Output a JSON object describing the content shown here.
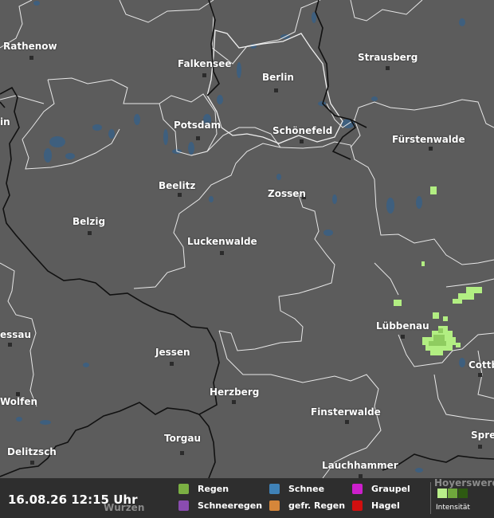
{
  "map": {
    "cities": [
      {
        "name": "Rathenow",
        "id": "rathenow"
      },
      {
        "name": "Falkensee",
        "id": "falkensee"
      },
      {
        "name": "Berlin",
        "id": "berlin"
      },
      {
        "name": "Strausberg",
        "id": "strausberg"
      },
      {
        "name": "Potsdam",
        "id": "potsdam"
      },
      {
        "name": "Schönefeld",
        "id": "schoenefeld"
      },
      {
        "name": "Fürstenwalde",
        "id": "fuerstenwalde"
      },
      {
        "name": "Beelitz",
        "id": "beelitz"
      },
      {
        "name": "Zossen",
        "id": "zossen"
      },
      {
        "name": "Belzig",
        "id": "belzig"
      },
      {
        "name": "Luckenwalde",
        "id": "luckenwalde"
      },
      {
        "name": "Lübbenau",
        "id": "luebbenau"
      },
      {
        "name": "Jessen",
        "id": "jessen"
      },
      {
        "name": "Herzberg",
        "id": "herzberg"
      },
      {
        "name": "Finsterwalde",
        "id": "finsterwalde"
      },
      {
        "name": "Torgau",
        "id": "torgau"
      },
      {
        "name": "Delitzsch",
        "id": "delitzsch"
      },
      {
        "name": "Lauchhammer",
        "id": "lauchhammer"
      },
      {
        "name": "Wolfen",
        "id": "wolfen"
      },
      {
        "name": "essau",
        "id": "dessau"
      },
      {
        "name": "Cottb",
        "id": "cottbus"
      },
      {
        "name": "Spre",
        "id": "spremberg"
      },
      {
        "name": "in",
        "id": "brandenburg"
      }
    ],
    "faded_labels": {
      "hoyerswerda": "Hoyerswerda",
      "wurzen": "Wurzen"
    }
  },
  "legend": {
    "timestamp": "16.08.26 12:15 Uhr",
    "items": [
      {
        "label": "Regen",
        "color": "#7bb043",
        "id": "rain"
      },
      {
        "label": "Schnee",
        "color": "#3f82b8",
        "id": "snow"
      },
      {
        "label": "Graupel",
        "color": "#cc1fcc",
        "id": "graupel"
      },
      {
        "label": "Schneeregen",
        "color": "#8a4cb0",
        "id": "sleet"
      },
      {
        "label": "gefr. Regen",
        "color": "#d6863a",
        "id": "freezing-rain"
      },
      {
        "label": "Hagel",
        "color": "#d00f0f",
        "id": "hail"
      }
    ],
    "intensity_label": "Intensität",
    "intensity_colors": [
      "#b9ef8a",
      "#6fa83c",
      "#2e5a12"
    ]
  },
  "colors": {
    "land": "#5c5c5c",
    "water": "#3e5f7e",
    "borders_thin": "#e8e8e8",
    "borders_thick": "#111111",
    "precip_light": "#b2ee82"
  }
}
